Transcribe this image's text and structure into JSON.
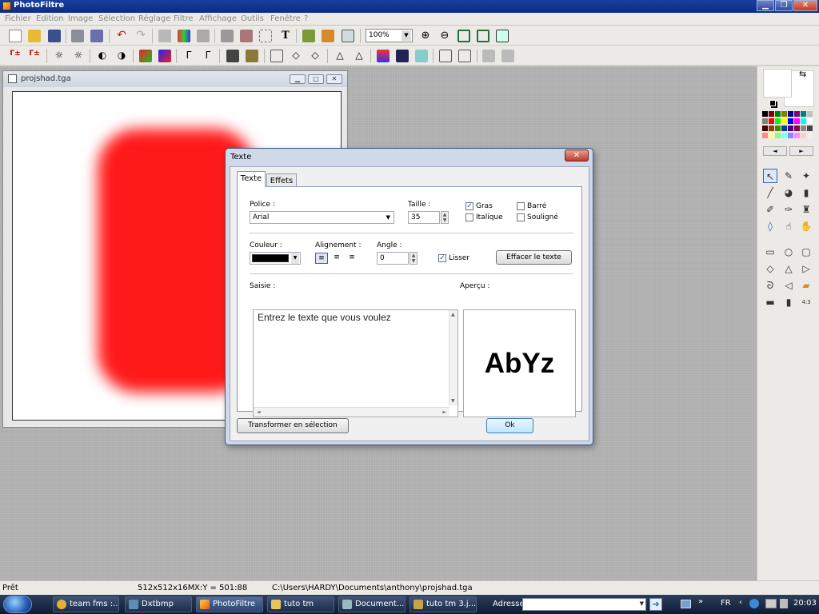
{
  "window": {
    "title": "PhotoFiltre"
  },
  "menu": [
    "Fichier",
    "Edition",
    "Image",
    "Sélection",
    "Réglage",
    "Filtre",
    "Affichage",
    "Outils",
    "Fenêtre",
    "?"
  ],
  "toolbar": {
    "zoom": "100%"
  },
  "image_window": {
    "title": "projshad.tga"
  },
  "dialog": {
    "title": "Texte",
    "tabs": [
      "Texte",
      "Effets"
    ],
    "police_label": "Police :",
    "police_value": "Arial",
    "taille_label": "Taille :",
    "taille_value": "35",
    "gras_label": "Gras",
    "gras_checked": true,
    "italique_label": "Italique",
    "italique_checked": false,
    "barre_label": "Barré",
    "barre_checked": false,
    "souligne_label": "Souligné",
    "souligne_checked": false,
    "couleur_label": "Couleur :",
    "couleur_value": "#000000",
    "alignement_label": "Alignement :",
    "angle_label": "Angle :",
    "angle_value": "0",
    "lisser_label": "Lisser",
    "lisser_checked": true,
    "effacer_button": "Effacer le texte",
    "saisie_label": "Saisie :",
    "saisie_text": "Entrez le texte que vous voulez",
    "apercu_label": "Aperçu :",
    "apercu_text": "AbYz",
    "transformer_button": "Transformer en sélection",
    "ok_button": "Ok"
  },
  "status": {
    "state": "Prêt",
    "image_info": "512x512x16M",
    "coords": "X:Y = 501:88",
    "path": "C:\\Users\\HARDY\\Documents\\anthony\\projshad.tga"
  },
  "taskbar": {
    "tasks": [
      "team fms :...",
      "Dxtbmp",
      "PhotoFiltre",
      "tuto tm",
      "Document....",
      "tuto tm 3.j..."
    ],
    "address_label": "Adresse",
    "language": "FR",
    "clock": "20:03"
  }
}
